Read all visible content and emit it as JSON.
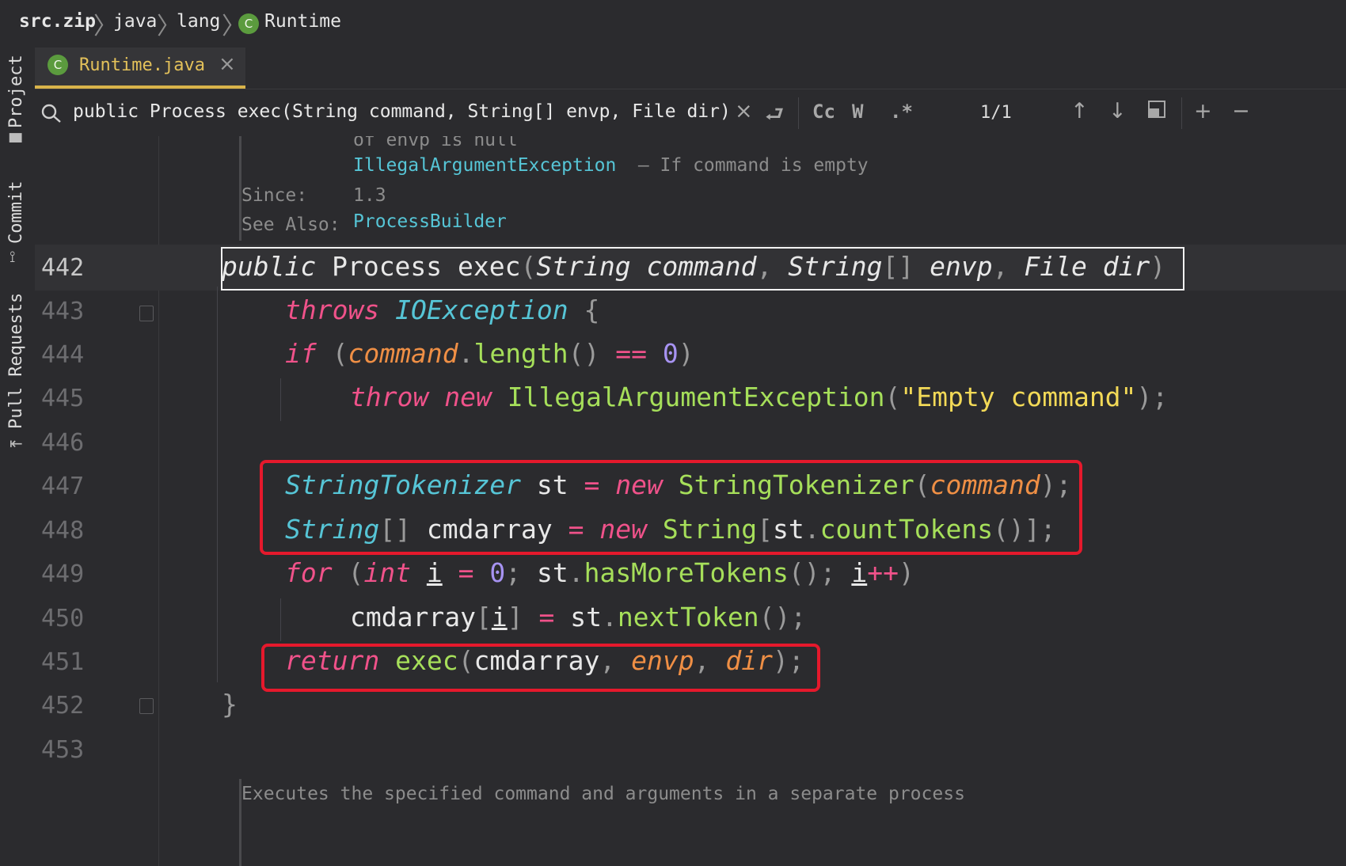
{
  "breadcrumb": {
    "items": [
      "src.zip",
      "java",
      "lang",
      "Runtime"
    ],
    "separator": "〉",
    "class_badge": "C"
  },
  "tool_windows": {
    "project": "Project",
    "commit": "Commit",
    "pull_requests": "Pull Requests"
  },
  "editor_tab": {
    "badge": "C",
    "title": "Runtime.java"
  },
  "search": {
    "query": "public Process exec(String command, String[] envp, File dir)",
    "match_case_label": "Cc",
    "words_label": "W",
    "regex_label": ".*",
    "match_count": "1/1"
  },
  "javadoc_top": {
    "line1": "of envp is null",
    "exception_link": "IllegalArgumentException",
    "exception_desc": " — If command is empty",
    "since_label": "Since:",
    "since_value": "1.3",
    "see_also_label": "See Also:",
    "see_also_link": "ProcessBuilder"
  },
  "line_numbers": [
    "442",
    "443",
    "444",
    "445",
    "446",
    "447",
    "448",
    "449",
    "450",
    "451",
    "452",
    "453"
  ],
  "javadoc_bottom": {
    "text": "Executes the specified command and arguments in a separate process"
  },
  "colors": {
    "background": "#2b2b2e",
    "keyword": "#f0528a",
    "type": "#56c5d6",
    "function": "#a6df5a",
    "parameter": "#ef8f45",
    "number": "#a793f2",
    "string": "#f2d957",
    "highlight_red": "#e5192c",
    "tab_accent": "#d9b44a"
  }
}
